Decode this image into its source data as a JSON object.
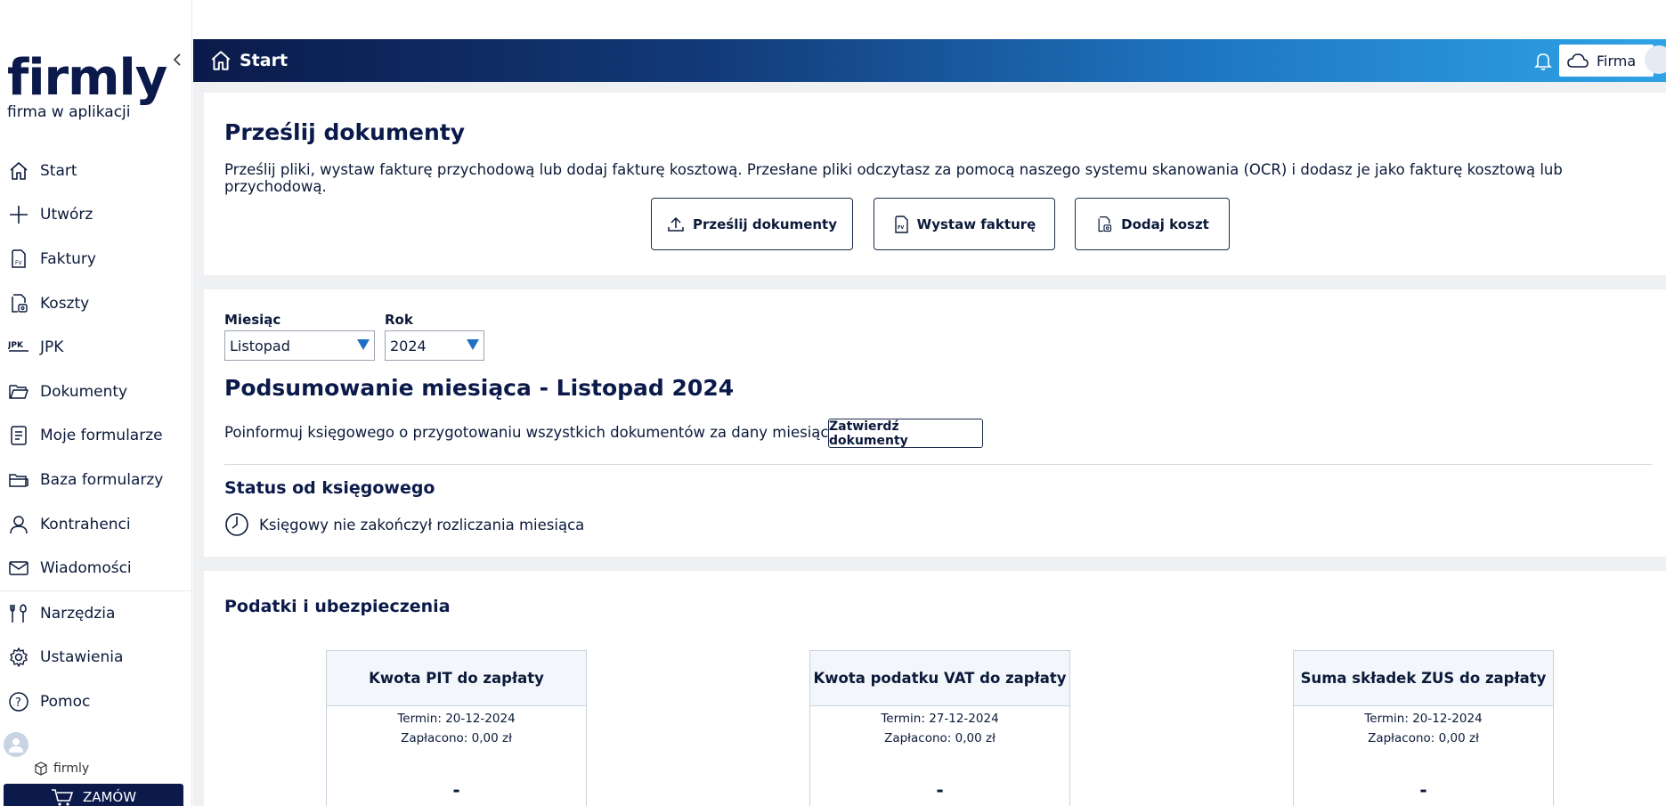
{
  "brand": {
    "logo": "firmly",
    "tagline": "firma w aplikacji"
  },
  "sidebar": {
    "items": [
      {
        "label": "Start",
        "icon": "home-icon"
      },
      {
        "label": "Utwórz",
        "icon": "plus-icon"
      },
      {
        "label": "Faktury",
        "icon": "invoice-icon"
      },
      {
        "label": "Koszty",
        "icon": "costs-icon"
      },
      {
        "label": "JPK",
        "icon": "jpk-icon"
      },
      {
        "label": "Dokumenty",
        "icon": "folder-icon"
      },
      {
        "label": "Moje formularze",
        "icon": "form-icon"
      },
      {
        "label": "Baza formularzy",
        "icon": "folders-icon"
      },
      {
        "label": "Kontrahenci",
        "icon": "person-icon"
      },
      {
        "label": "Wiadomości",
        "icon": "mail-icon"
      },
      {
        "label": "Narzędzia",
        "icon": "tools-icon"
      },
      {
        "label": "Ustawienia",
        "icon": "gear-icon"
      },
      {
        "label": "Pomoc",
        "icon": "help-icon"
      }
    ],
    "company": "firmly",
    "order_button": "ZAMÓW"
  },
  "topbar": {
    "title": "Start",
    "firma_button": "Firma"
  },
  "upload_section": {
    "title": "Prześlij dokumenty",
    "description": "Prześlij pliki, wystaw fakturę przychodową lub dodaj fakturę kosztową. Przesłane pliki odczytasz za pomocą naszego systemu skanowania (OCR) i dodasz je jako fakturę kosztową lub przychodową.",
    "buttons": [
      "Prześlij dokumenty",
      "Wystaw fakturę",
      "Dodaj koszt"
    ]
  },
  "summary_section": {
    "month_label": "Miesiąc",
    "month_value": "Listopad",
    "year_label": "Rok",
    "year_value": "2024",
    "title": "Podsumowanie miesiąca - Listopad 2024",
    "inform_text": "Poinformuj księgowego o przygotowaniu wszystkich dokumentów za dany miesiąc",
    "confirm_button": "Zatwierdź dokumenty",
    "status_title": "Status od księgowego",
    "status_text": "Księgowy nie zakończył rozliczania miesiąca"
  },
  "taxes_section": {
    "title": "Podatki i ubezpieczenia",
    "boxes": [
      {
        "title": "Kwota PIT do zapłaty",
        "deadline": "Termin: 20-12-2024",
        "paid": "Zapłacono: 0,00 zł",
        "amount": "-"
      },
      {
        "title": "Kwota podatku VAT do zapłaty",
        "deadline": "Termin: 27-12-2024",
        "paid": "Zapłacono: 0,00 zł",
        "amount": "-"
      },
      {
        "title": "Suma składek ZUS do zapłaty",
        "deadline": "Termin: 20-12-2024",
        "paid": "Zapłacono: 0,00 zł",
        "amount": "-"
      }
    ]
  },
  "colors": {
    "navy": "#0b1a4a",
    "accent": "#1f6fc4",
    "gradient_end": "#2fa3e6"
  }
}
